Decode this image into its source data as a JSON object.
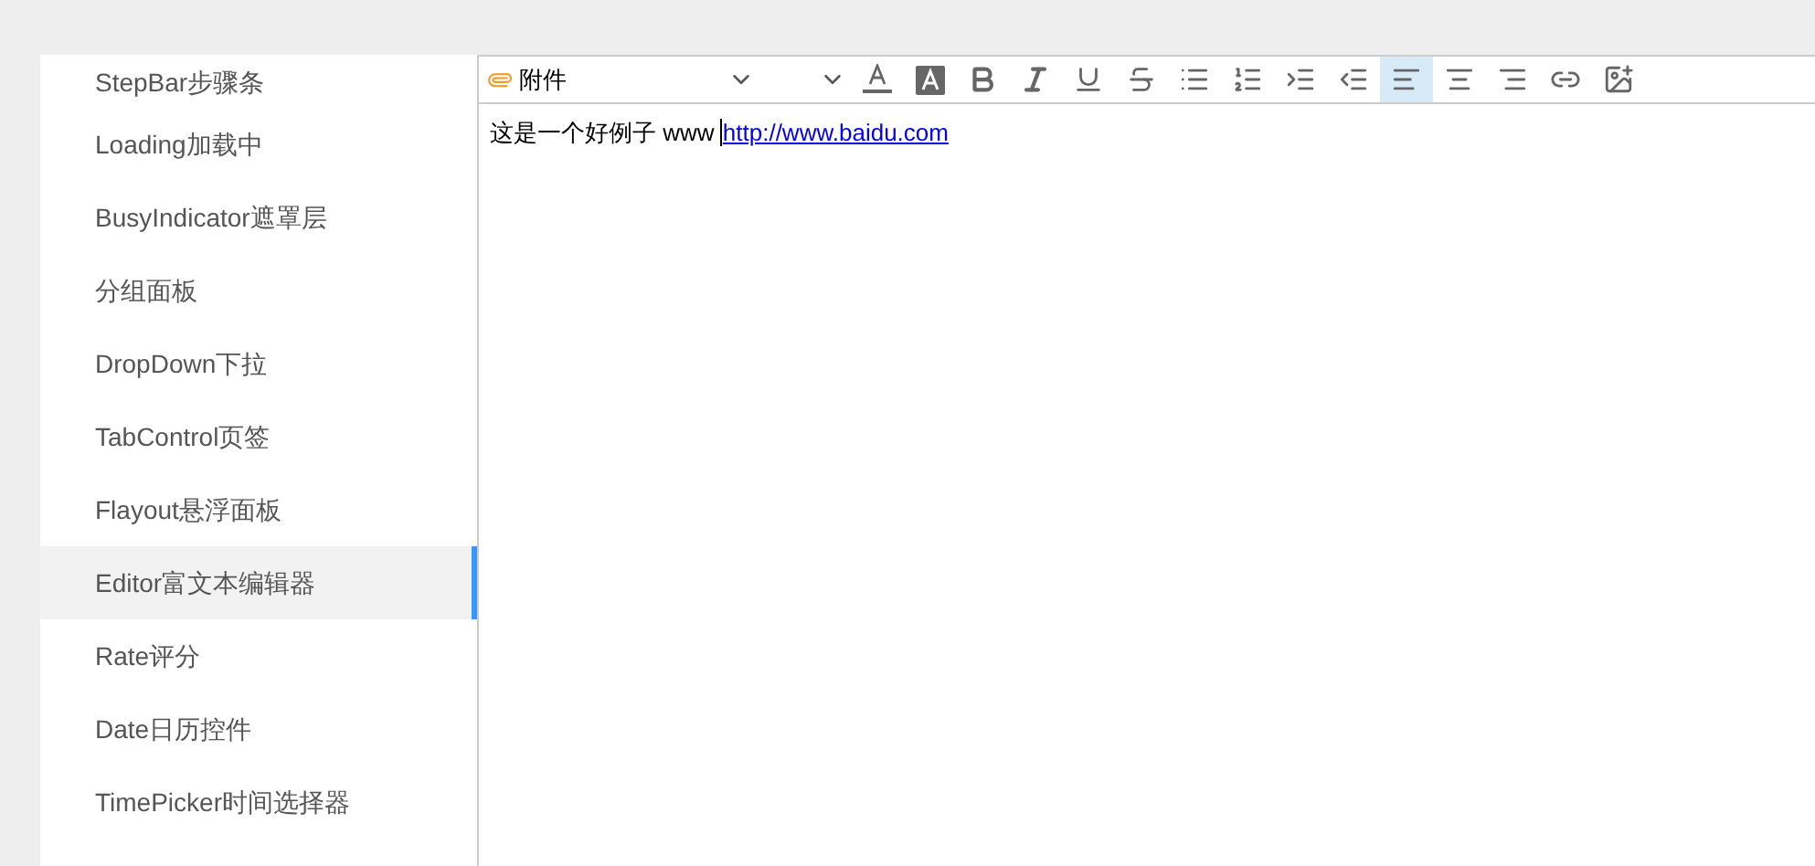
{
  "sidebar": {
    "items": [
      {
        "label": "StepBar步骤条",
        "selected": false
      },
      {
        "label": "Loading加载中",
        "selected": false
      },
      {
        "label": "BusyIndicator遮罩层",
        "selected": false
      },
      {
        "label": "分组面板",
        "selected": false
      },
      {
        "label": "DropDown下拉",
        "selected": false
      },
      {
        "label": "TabControl页签",
        "selected": false
      },
      {
        "label": "Flayout悬浮面板",
        "selected": false
      },
      {
        "label": "Editor富文本编辑器",
        "selected": true
      },
      {
        "label": "Rate评分",
        "selected": false
      },
      {
        "label": "Date日历控件",
        "selected": false
      },
      {
        "label": "TimePicker时间选择器",
        "selected": false
      }
    ]
  },
  "editor": {
    "toolbar": {
      "dropdowns": [
        {
          "kind": "attachment",
          "value": "附件"
        },
        {
          "kind": "blank"
        }
      ],
      "buttons": [
        {
          "kind": "font-color",
          "selected": false
        },
        {
          "kind": "back-color",
          "selected": false
        },
        {
          "kind": "bold",
          "selected": false
        },
        {
          "kind": "italic",
          "selected": false
        },
        {
          "kind": "underline",
          "selected": false
        },
        {
          "kind": "strike",
          "selected": false
        },
        {
          "kind": "bullets",
          "selected": false
        },
        {
          "kind": "numbers",
          "selected": false
        },
        {
          "kind": "indent",
          "selected": false
        },
        {
          "kind": "outdent",
          "selected": false
        },
        {
          "kind": "align-left",
          "selected": true
        },
        {
          "kind": "align-center",
          "selected": false
        },
        {
          "kind": "align-right",
          "selected": false
        },
        {
          "kind": "link",
          "selected": false
        },
        {
          "kind": "image",
          "selected": false
        }
      ]
    },
    "content": {
      "text": "这是一个好例子 www",
      "link": "http://www.baidu.com"
    }
  }
}
